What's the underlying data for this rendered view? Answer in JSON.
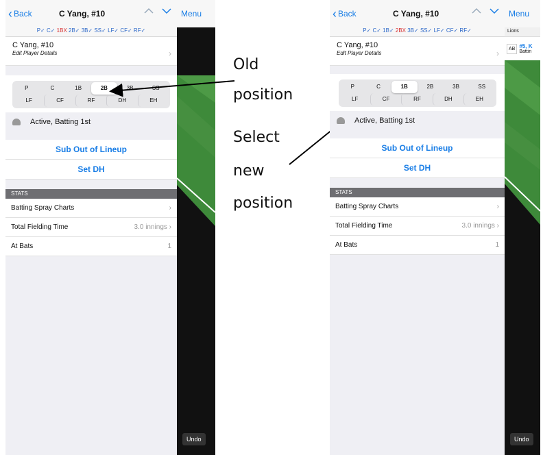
{
  "left": {
    "nav": {
      "back": "Back",
      "title": "C Yang, #10"
    },
    "positions_line": [
      "P✓",
      "C✓",
      "1BX",
      "2B✓",
      "3B✓",
      "SS✓",
      "LF✓",
      "CF✓",
      "RF✓"
    ],
    "player": {
      "name": "C Yang, #10",
      "subtitle": "Edit Player Details"
    },
    "seg_row1": [
      "P",
      "C",
      "1B",
      "2B",
      "3B",
      "SS"
    ],
    "seg_row2": [
      "LF",
      "CF",
      "RF",
      "DH",
      "EH"
    ],
    "status": "Active, Batting 1st",
    "actions": [
      "Sub Out of Lineup",
      "Set DH"
    ],
    "stats_header": "STATS",
    "stats": [
      {
        "label": "Batting Spray Charts",
        "value": ""
      },
      {
        "label": "Total Fielding Time",
        "value": "3.0 innings"
      },
      {
        "label": "At Bats",
        "value": "1"
      }
    ],
    "sidebar": {
      "menu": "Menu",
      "undo": "Undo"
    }
  },
  "right": {
    "nav": {
      "back": "Back",
      "title": "C Yang, #10"
    },
    "positions_line": [
      "P✓",
      "C✓",
      "1B✓",
      "2BX",
      "3B✓",
      "SS✓",
      "LF✓",
      "CF✓",
      "RF✓"
    ],
    "player": {
      "name": "C Yang, #10",
      "subtitle": "Edit Player Details"
    },
    "seg_row1": [
      "P",
      "C",
      "1B",
      "2B",
      "3B",
      "SS"
    ],
    "seg_row2": [
      "LF",
      "CF",
      "RF",
      "DH",
      "EH"
    ],
    "status": "Active, Batting 1st",
    "actions": [
      "Sub Out of Lineup",
      "Set DH"
    ],
    "stats_header": "STATS",
    "stats": [
      {
        "label": "Batting Spray Charts",
        "value": ""
      },
      {
        "label": "Total Fielding Time",
        "value": "3.0 innings"
      },
      {
        "label": "At Bats",
        "value": "1"
      }
    ],
    "sidebar": {
      "menu": "Menu",
      "team": "Lions",
      "ab": "AB",
      "batter": "#5, K",
      "batting": "Battin",
      "undo": "Undo"
    }
  },
  "annotations": {
    "old_1": "Old",
    "old_2": "position",
    "new_1": "Select",
    "new_2": "new",
    "new_3": "position"
  },
  "selected_left": "2B",
  "selected_right": "1B",
  "colors": {
    "accent": "#1a7ee6",
    "error": "#d63031",
    "field_green": "#3e8a3a"
  }
}
